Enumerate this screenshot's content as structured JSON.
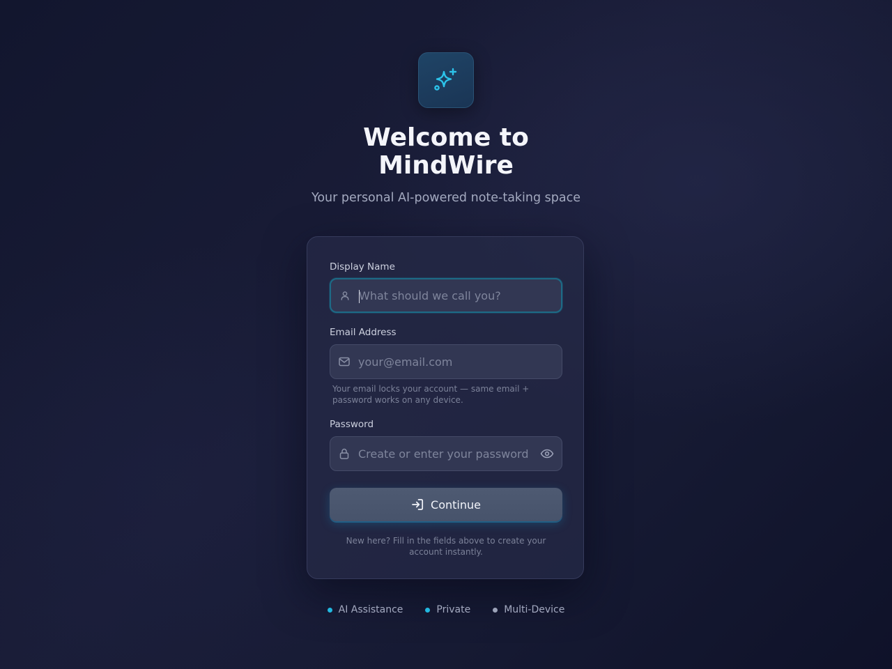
{
  "header": {
    "logo_icon": "sparkles-icon",
    "title": "Welcome to MindWire",
    "subtitle": "Your personal AI-powered note-taking space"
  },
  "form": {
    "display_name": {
      "label": "Display Name",
      "placeholder": "What should we call you?",
      "value": "",
      "icon": "user-icon"
    },
    "email": {
      "label": "Email Address",
      "placeholder": "your@email.com",
      "value": "",
      "icon": "mail-icon",
      "hint": "Your email locks your account — same email + password works on any device."
    },
    "password": {
      "label": "Password",
      "placeholder": "Create or enter your password",
      "value": "",
      "icon": "lock-icon",
      "toggle_icon": "eye-icon"
    },
    "continue_button": {
      "label": "Continue",
      "icon": "log-in-icon"
    },
    "footnote": "New here? Fill in the fields above to create your account instantly."
  },
  "features": [
    {
      "label": "AI Assistance",
      "dot_color": "#22b8e0"
    },
    {
      "label": "Private",
      "dot_color": "#22b8e0"
    },
    {
      "label": "Multi-Device",
      "dot_color": "#9ca3b8"
    }
  ],
  "colors": {
    "accent": "#22b8e0",
    "focus_ring": "#1d6a86",
    "button": "#4a566e"
  }
}
